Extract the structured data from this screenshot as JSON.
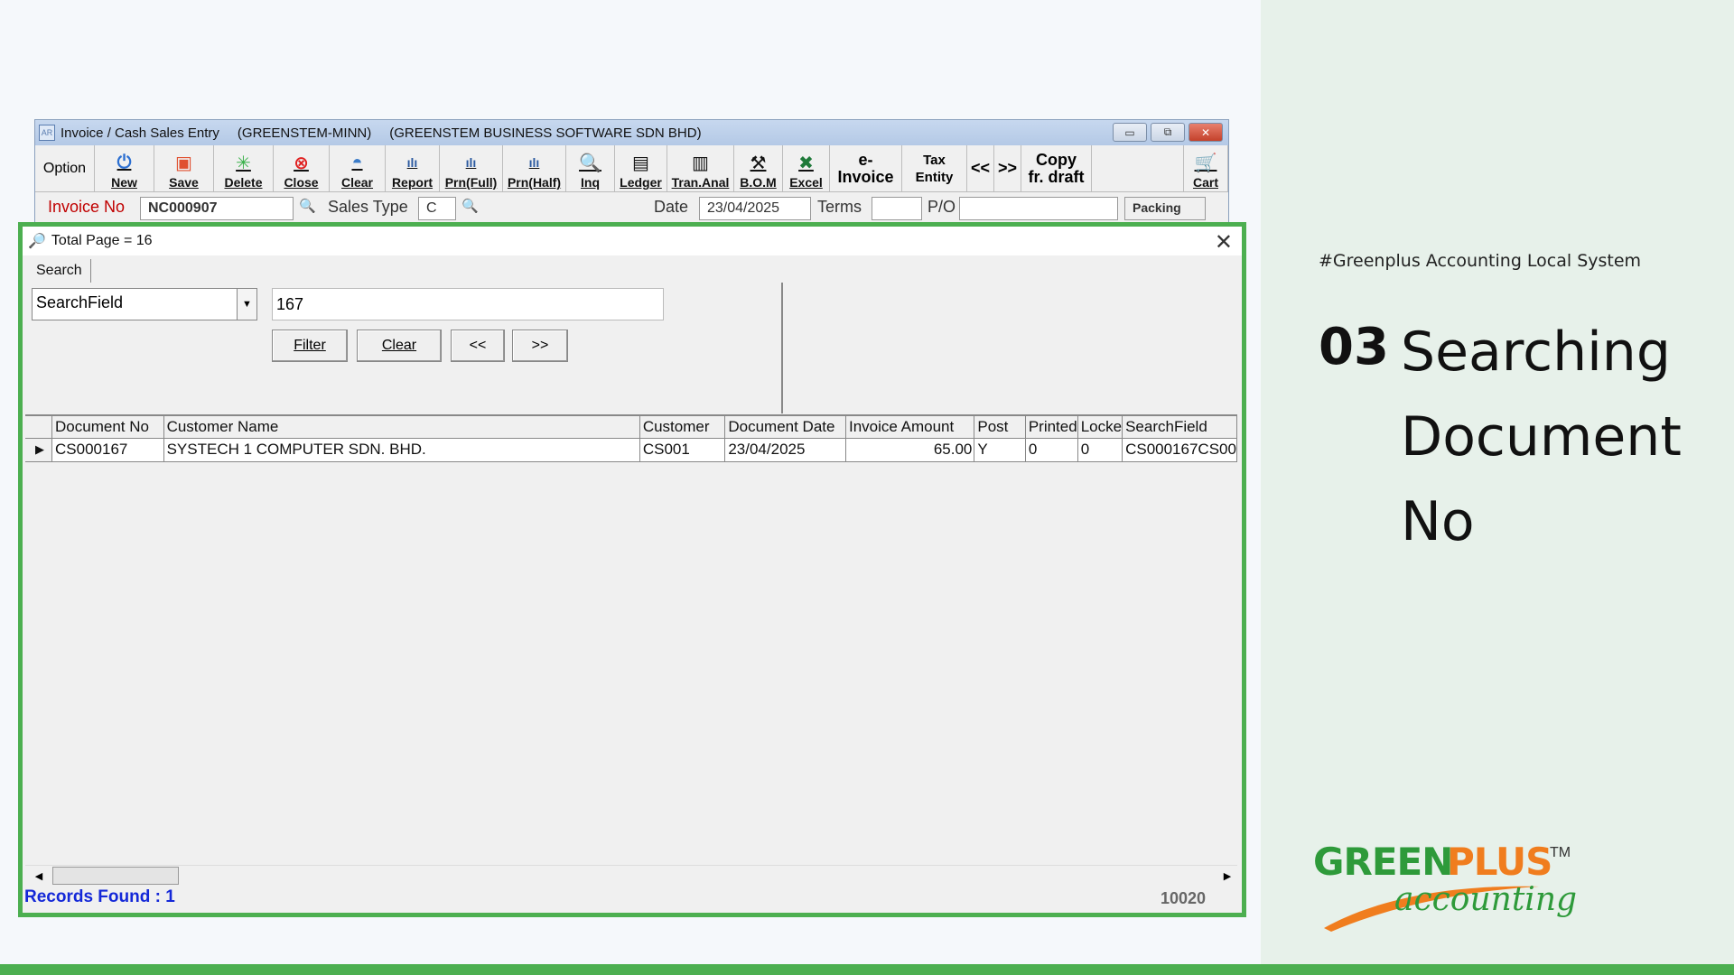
{
  "window": {
    "title": "Invoice / Cash Sales Entry",
    "user": "(GREENSTEM-MINN)",
    "company": "(GREENSTEM BUSINESS SOFTWARE SDN BHD)"
  },
  "toolbar": {
    "option": "Option",
    "new": "New",
    "save": "Save",
    "delete": "Delete",
    "close": "Close",
    "clear": "Clear",
    "report": "Report",
    "prn_full": "Prn(Full)",
    "prn_half": "Prn(Half)",
    "inq": "Inq",
    "ledger": "Ledger",
    "tran_anal": "Tran.Anal",
    "bom": "B.O.M",
    "excel": "Excel",
    "einvoice": "e-Invoice",
    "tax_entity": "Tax Entity",
    "prev": "<<",
    "next": ">>",
    "copy_draft": "Copy fr. draft",
    "cart": "Cart"
  },
  "invoice": {
    "invoice_no_label": "Invoice No",
    "invoice_no": "NC000907",
    "sales_type_label": "Sales Type",
    "sales_type": "C",
    "date_label": "Date",
    "date": "23/04/2025",
    "terms_label": "Terms",
    "po_label": "P/O",
    "packing": "Packing"
  },
  "dialog": {
    "title": "Total Page = 16",
    "tab": "Search",
    "search_field": "SearchField",
    "search_value": "167",
    "filter": "Filter",
    "clear": "Clear",
    "prev": "<<",
    "next": ">>",
    "columns": [
      "Document No",
      "Customer Name",
      "Customer",
      "Document Date",
      "Invoice Amount",
      "Post",
      "Printed",
      "Locke",
      "SearchField"
    ],
    "rows": [
      [
        "CS000167",
        "SYSTECH 1 COMPUTER SDN. BHD.",
        "CS001",
        "23/04/2025",
        "65.00",
        "Y",
        "0",
        "0",
        "CS000167CS00"
      ]
    ],
    "records_found": "Records Found : 1",
    "code": "10020"
  },
  "side": {
    "hashtag": "#Greenplus Accounting Local System",
    "step": "03",
    "title": "Searching Document No",
    "logo_green": "GREEN",
    "logo_plus": "PLUS",
    "logo_tm": "TM",
    "logo_sub": "accounting"
  },
  "colors": {
    "green_border": "#4caf50",
    "records_blue": "#1428d8",
    "logo_green": "#2e9a3a",
    "logo_orange": "#f07d1e"
  }
}
